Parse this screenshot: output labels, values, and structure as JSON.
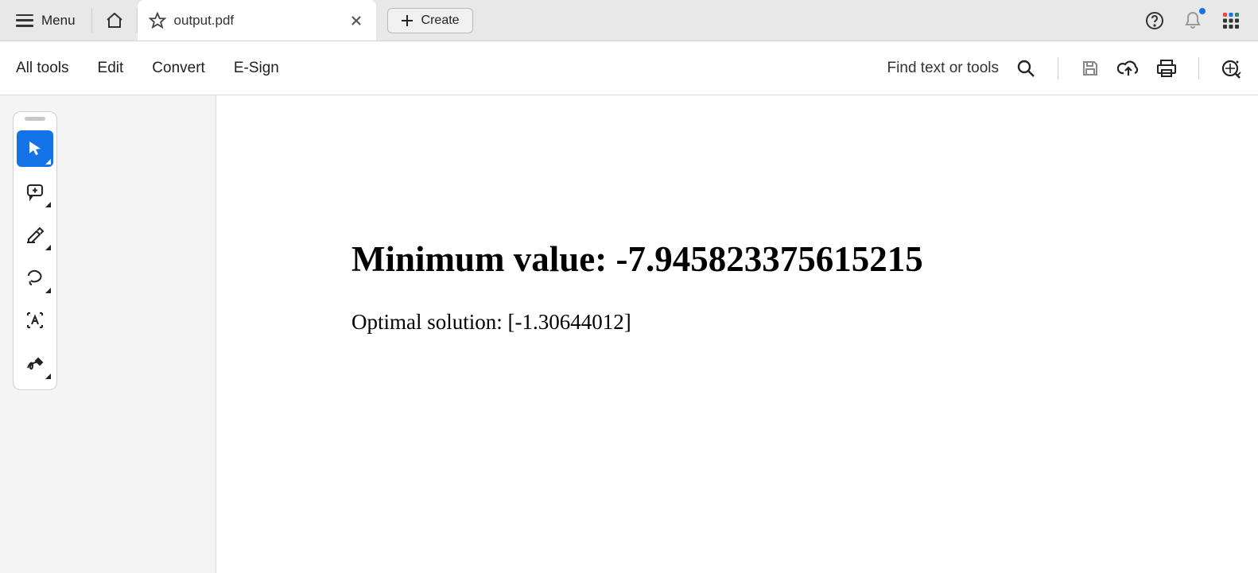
{
  "titlebar": {
    "menu_label": "Menu",
    "tab_title": "output.pdf",
    "create_label": "Create"
  },
  "toolbar2": {
    "items": [
      "All tools",
      "Edit",
      "Convert",
      "E-Sign"
    ],
    "find_label": "Find text or tools"
  },
  "document": {
    "heading": "Minimum value: -7.945823375615215",
    "body": "Optimal solution: [-1.30644012]"
  }
}
